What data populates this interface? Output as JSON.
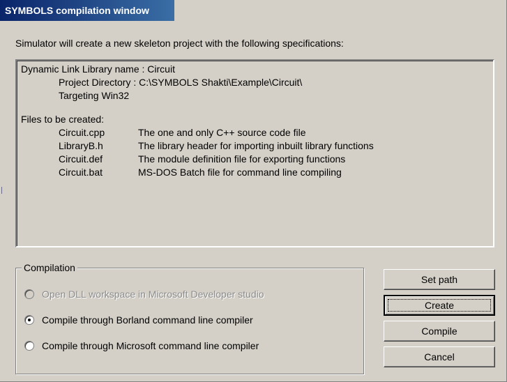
{
  "window": {
    "title": "SYMBOLS compilation window"
  },
  "intro_text": "Simulator will create a new skeleton project with the following specifications:",
  "specification": {
    "dll_name_line": "Dynamic Link Library name : Circuit",
    "project_directory_line": "Project Directory : C:\\SYMBOLS Shakti\\Example\\Circuit\\",
    "targeting_line": "Targeting Win32",
    "files_heading": "Files to be created:",
    "files": [
      {
        "name": "Circuit.cpp",
        "description": "The one and only C++ source code file"
      },
      {
        "name": "LibraryB.h",
        "description": "The library header for importing inbuilt library functions"
      },
      {
        "name": "Circuit.def",
        "description": "The module definition file for exporting functions"
      },
      {
        "name": "Circuit.bat",
        "description": "MS-DOS Batch file for command line compiling"
      }
    ]
  },
  "compilation": {
    "label": "Compilation",
    "options": [
      {
        "label": "Open DLL workspace in Microsoft Developer studio",
        "enabled": false,
        "selected": false
      },
      {
        "label": "Compile through Borland command line compiler",
        "enabled": true,
        "selected": true
      },
      {
        "label": "Compile through Microsoft command line compiler",
        "enabled": true,
        "selected": false
      }
    ]
  },
  "buttons": {
    "set_path": "Set path",
    "create": "Create",
    "compile": "Compile",
    "cancel": "Cancel"
  }
}
